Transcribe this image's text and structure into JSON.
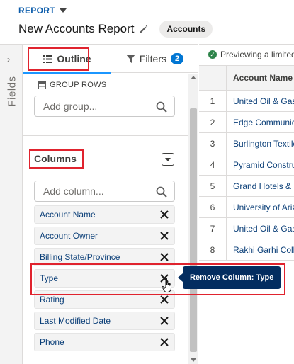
{
  "header": {
    "report_type": "REPORT",
    "title": "New Accounts Report",
    "object_badge": "Accounts"
  },
  "rail": {
    "label": "Fields"
  },
  "tabs": {
    "outline": "Outline",
    "filters": "Filters",
    "filters_count": "2"
  },
  "group_rows": {
    "label": "GROUP ROWS",
    "placeholder": "Add group..."
  },
  "columns": {
    "heading": "Columns",
    "placeholder": "Add column...",
    "items": [
      "Account Name",
      "Account Owner",
      "Billing State/Province",
      "Type",
      "Rating",
      "Last Modified Date",
      "Phone"
    ]
  },
  "tooltip": "Remove Column: Type",
  "preview": {
    "banner": "Previewing a limited number of records",
    "column_header": "Account Name",
    "rows": [
      {
        "num": "1",
        "name": "United Oil & Gas Corp."
      },
      {
        "num": "2",
        "name": "Edge Communications"
      },
      {
        "num": "3",
        "name": "Burlington Textiles"
      },
      {
        "num": "4",
        "name": "Pyramid Construction"
      },
      {
        "num": "5",
        "name": "Grand Hotels & Resorts"
      },
      {
        "num": "6",
        "name": "University of Arizona"
      },
      {
        "num": "7",
        "name": "United Oil & Gas Ltd."
      },
      {
        "num": "8",
        "name": "Rakhi Garhi Collections"
      }
    ]
  },
  "colors": {
    "brand_blue": "#0176d3",
    "highlight_red": "#e0232e",
    "tooltip_bg": "#032d60"
  }
}
